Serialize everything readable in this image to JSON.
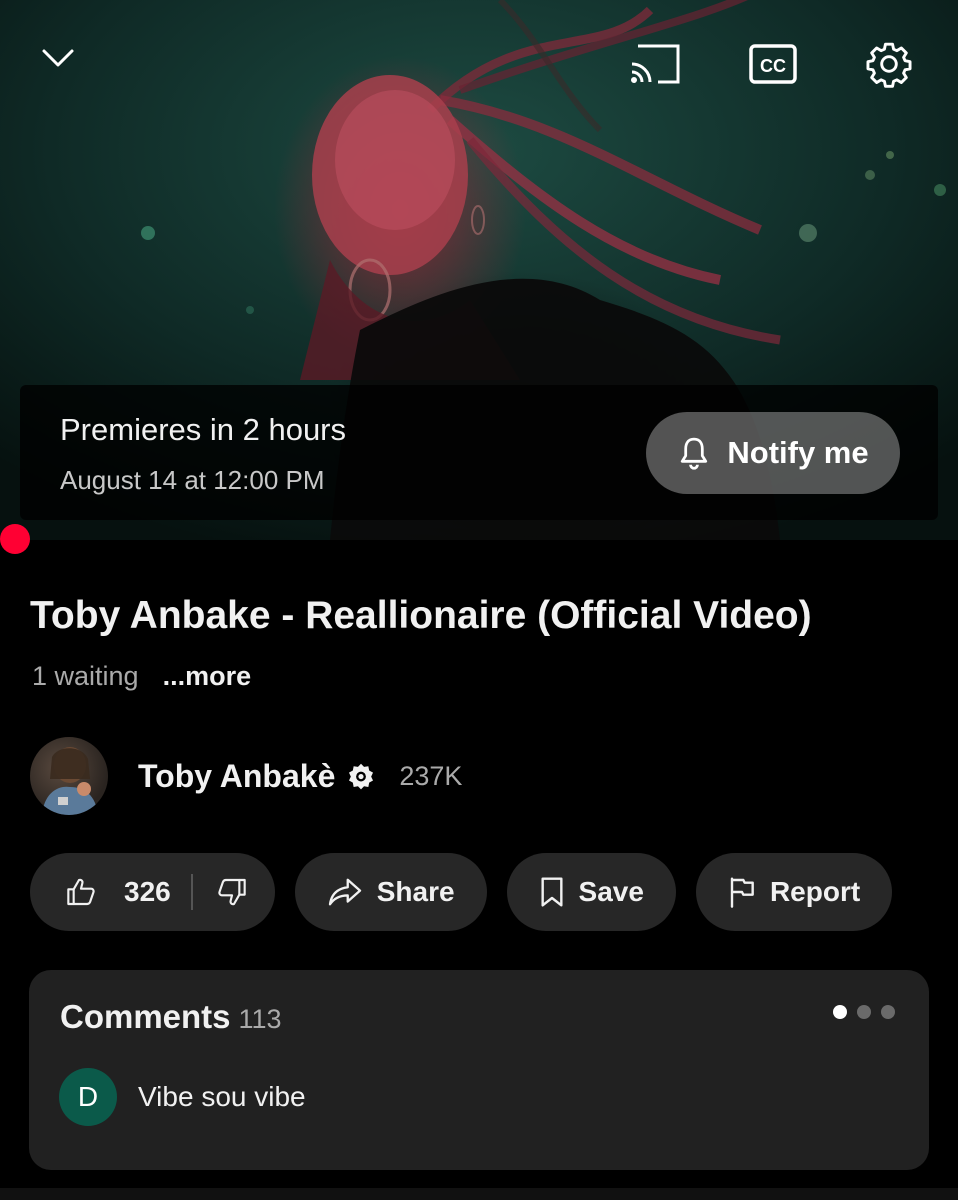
{
  "player": {
    "icons": {
      "collapse": "chevron-down-icon",
      "cast": "cast-icon",
      "captions": "closed-captions-icon",
      "settings": "gear-icon"
    },
    "premiere_title": "Premieres in 2 hours",
    "premiere_date": "August 14 at 12:00 PM",
    "notify_label": "Notify me",
    "progress_color": "#ff0033"
  },
  "video": {
    "title": "Toby Anbake - Reallionaire (Official Video)",
    "waiting": "1 waiting",
    "more_label": "...more"
  },
  "channel": {
    "name": "Toby Anbakè",
    "subscribers": "237K",
    "verified": true
  },
  "actions": {
    "likes": "326",
    "share_label": "Share",
    "save_label": "Save",
    "report_label": "Report"
  },
  "comments": {
    "title": "Comments",
    "count": "113",
    "first_comment": {
      "avatar_letter": "D",
      "text": "Vibe sou vibe"
    },
    "page_indicator": {
      "total": 3,
      "active": 1
    }
  },
  "colors": {
    "background": "#000000",
    "card": "#212121",
    "pill": "#272727",
    "accent_red": "#ff0033",
    "comment_avatar": "#0b5a4a"
  }
}
